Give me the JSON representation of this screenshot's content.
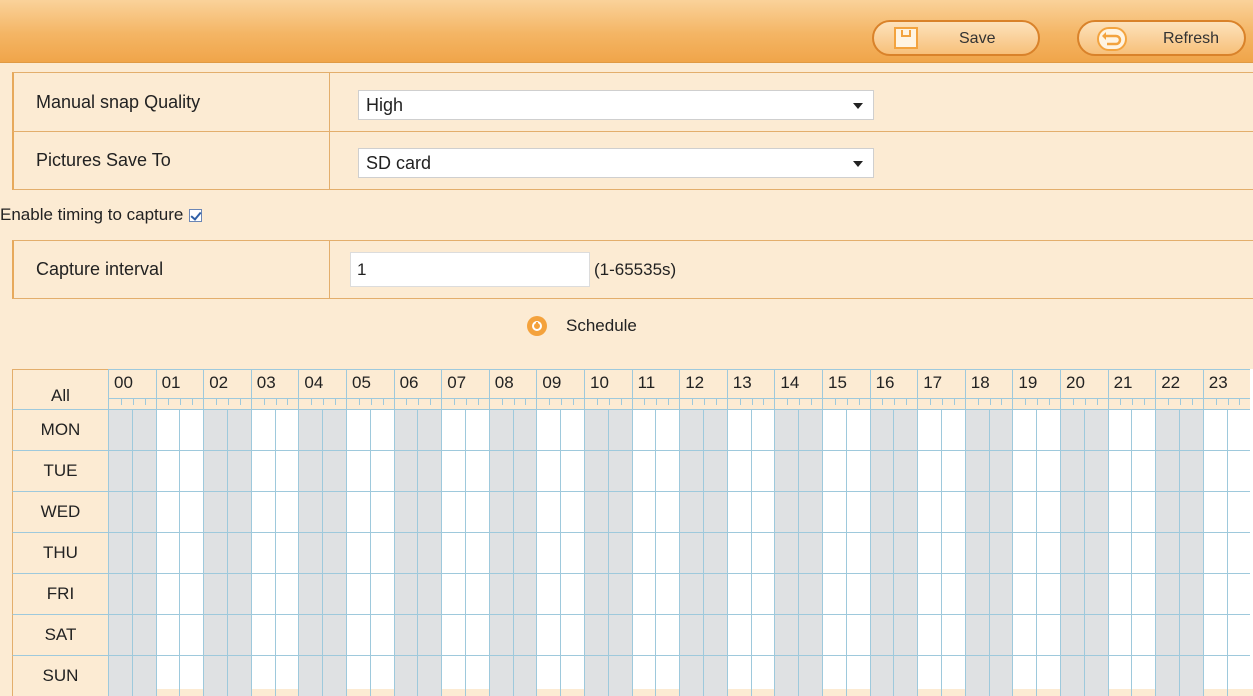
{
  "toolbar": {
    "save_label": "Save",
    "refresh_label": "Refresh"
  },
  "form": {
    "quality": {
      "label": "Manual snap Quality",
      "value": "High"
    },
    "save_to": {
      "label": "Pictures Save To",
      "value": "SD card"
    },
    "enable_timing": {
      "label": "Enable timing to capture",
      "checked": true
    },
    "interval": {
      "label": "Capture interval",
      "value": "1",
      "hint": "(1-65535s)"
    }
  },
  "schedule": {
    "title": "Schedule",
    "all_label": "All",
    "hours": [
      "00",
      "01",
      "02",
      "03",
      "04",
      "05",
      "06",
      "07",
      "08",
      "09",
      "10",
      "11",
      "12",
      "13",
      "14",
      "15",
      "16",
      "17",
      "18",
      "19",
      "20",
      "21",
      "22",
      "23"
    ],
    "days": [
      "MON",
      "TUE",
      "WED",
      "THU",
      "FRI",
      "SAT",
      "SUN"
    ],
    "colors": {
      "even_hour": "#dfe1e3",
      "odd_hour": "#ffffff",
      "grid_line": "#9ec9dc"
    }
  }
}
